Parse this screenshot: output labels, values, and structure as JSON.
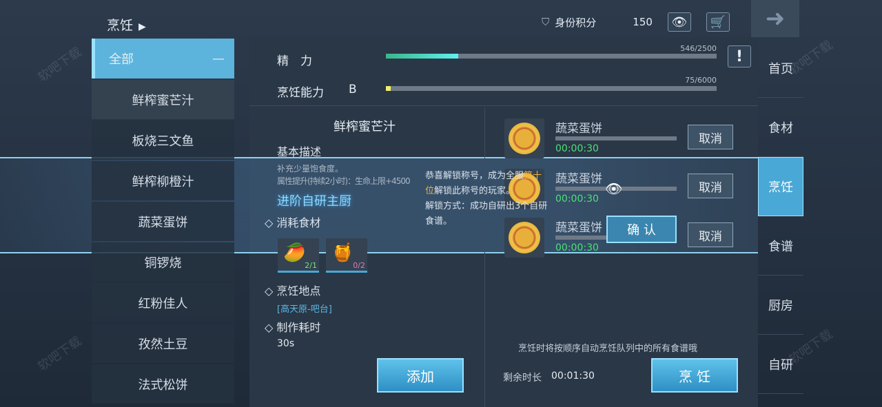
{
  "header": {
    "title": "烹饪",
    "identity_label": "身份积分",
    "identity_value": "150"
  },
  "categories": {
    "all_label": "全部",
    "collapse": "—",
    "items": [
      "鲜榨蜜芒汁",
      "板烧三文鱼",
      "鲜榨柳橙汁",
      "蔬菜蛋饼",
      "铜锣烧",
      "红粉佳人",
      "孜然土豆",
      "法式松饼"
    ],
    "selected": 0
  },
  "stats": {
    "energy_label": "精　力",
    "energy_value": "546/2500",
    "energy_fraction": 0.218,
    "cook_label": "烹饪能力",
    "cook_grade": "B",
    "cook_value": "75/6000",
    "cook_fraction": 0.0125,
    "info": "!"
  },
  "recipe": {
    "name": "鲜榨蜜芒汁",
    "desc_title": "基本描述",
    "desc_lines": [
      "补充少量饱食度。",
      "属性提升(持续2小时)：生命上限+4500"
    ],
    "ingredients_title": "消耗食材",
    "ingredients": [
      {
        "count": "2/1",
        "color": "#7de07d"
      },
      {
        "count": "0/2",
        "color": "#e07dae"
      }
    ],
    "location_title": "烹饪地点",
    "location": "[高天原-吧台]",
    "time_title": "制作耗时",
    "time": "30s",
    "add_button": "添加"
  },
  "queue": {
    "items": [
      {
        "name": "蔬菜蛋饼",
        "time": "00:00:30",
        "cancel": "取消"
      },
      {
        "name": "蔬菜蛋饼",
        "time": "00:00:30",
        "cancel": "取消"
      },
      {
        "name": "蔬菜蛋饼",
        "time": "00:00:30",
        "cancel": "取消"
      }
    ],
    "hint": "烹饪时将按顺序自动烹饪队列中的所有食谱哦",
    "remaining_label": "剩余时长",
    "remaining": "00:01:30",
    "cook_button": "烹 饪"
  },
  "nav": [
    "首页",
    "食材",
    "烹饪",
    "食谱",
    "厨房",
    "自研"
  ],
  "nav_active": 2,
  "popup": {
    "title": "进阶自研主厨",
    "line1_a": "恭喜解锁称号，成为全服",
    "line1_hl": "第十位",
    "line1_b": "解锁此称号的玩家。",
    "line2": "解锁方式：成功自研出3个自研食谱。",
    "confirm": "确 认"
  },
  "watermark": "软吧下载"
}
